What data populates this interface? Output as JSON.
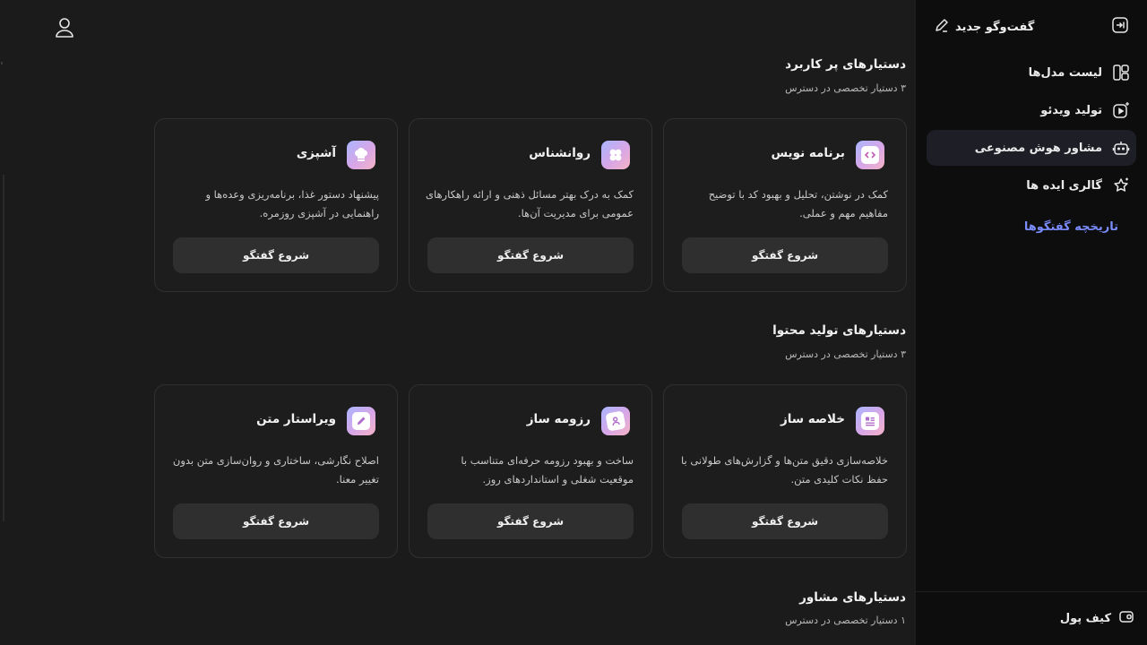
{
  "sidebar": {
    "new_chat_label": "گفت‌وگو جدید",
    "nav_items": [
      {
        "label": "لیست مدل‌ها",
        "icon": "layout-icon"
      },
      {
        "label": "تولید ویدئو",
        "icon": "video-sparkle-icon"
      },
      {
        "label": "مشاور هوش مصنوعی",
        "icon": "robot-icon",
        "active": true
      },
      {
        "label": "گالری ایده ها",
        "icon": "star-sparkle-icon"
      }
    ],
    "history_label": "تاریخچه گفتگوها",
    "wallet_label": "کیف پول"
  },
  "sections": [
    {
      "title": "دستیارهای پر کاربرد",
      "subtitle": "۳ دستیار تخصصی در دسترس",
      "cards": [
        {
          "title": "برنامه نویس",
          "description": "کمک در نوشتن، تحلیل و بهبود کد با توضیح مفاهیم مهم و عملی.",
          "button": "شروع گفتگو",
          "icon": "code-icon"
        },
        {
          "title": "روانشناس",
          "description": "کمک به درک بهتر مسائل ذهنی و ارائه راهکارهای عمومی برای مدیریت آن‌ها.",
          "button": "شروع گفتگو",
          "icon": "brain-icon"
        },
        {
          "title": "آشپزی",
          "description": "پیشنهاد دستور غذا، برنامه‌ریزی وعده‌ها و راهنمایی در آشپزی روزمره.",
          "button": "شروع گفتگو",
          "icon": "chef-hat-icon"
        }
      ]
    },
    {
      "title": "دستیارهای تولید محتوا",
      "subtitle": "۳ دستیار تخصصی در دسترس",
      "cards": [
        {
          "title": "خلاصه ساز",
          "description": "خلاصه‌سازی دقیق متن‌ها و گزارش‌های طولانی با حفظ نکات کلیدی متن.",
          "button": "شروع گفتگو",
          "icon": "document-lines-icon"
        },
        {
          "title": "رزومه ساز",
          "description": "ساخت و بهبود رزومه حرفه‌ای متناسب با موقعیت شغلی و استانداردهای روز.",
          "button": "شروع گفتگو",
          "icon": "resume-icon"
        },
        {
          "title": "ویراستار متن",
          "description": "اصلاح نگارشی، ساختاری و روان‌سازی متن بدون تغییر معنا.",
          "button": "شروع گفتگو",
          "icon": "pen-edit-icon"
        }
      ]
    },
    {
      "title": "دستیارهای مشاور",
      "subtitle": "۱ دستیار تخصصی در دسترس",
      "cards": []
    }
  ]
}
